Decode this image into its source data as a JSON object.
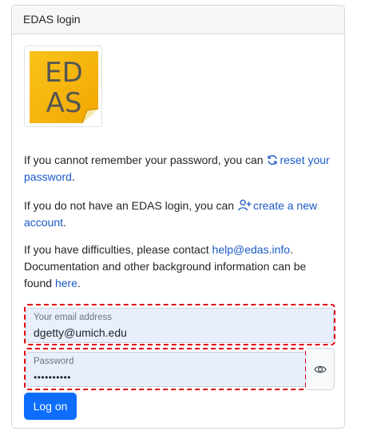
{
  "card": {
    "title": "EDAS login"
  },
  "logo": {
    "line1": "ED",
    "line2": "AS",
    "bg_color": "#f6b800"
  },
  "help": {
    "reset_pre": "If you cannot remember your password, you can",
    "reset_link": "reset your password",
    "reset_post": ".",
    "create_pre": "If you do not have an EDAS login, you can",
    "create_link": "create a new account",
    "create_post": ".",
    "contact_pre": "If you have difficulties, please contact",
    "contact_email": "help@edas.info",
    "contact_mid": ". Documentation and other background information can be found",
    "contact_here": "here",
    "contact_post": "."
  },
  "form": {
    "email_label": "Your email address",
    "email_value": "dgetty@umich.edu",
    "password_label": "Password",
    "password_value": "••••••••••",
    "submit_label": "Log on"
  },
  "icons": {
    "reset": "refresh-icon",
    "create": "add-user-icon",
    "reveal": "eye-icon"
  },
  "colors": {
    "link": "#1a59c7",
    "primary_button": "#0d6efd",
    "highlight_dash": "#e3000f",
    "autofill_bg": "#e8f0fe"
  }
}
